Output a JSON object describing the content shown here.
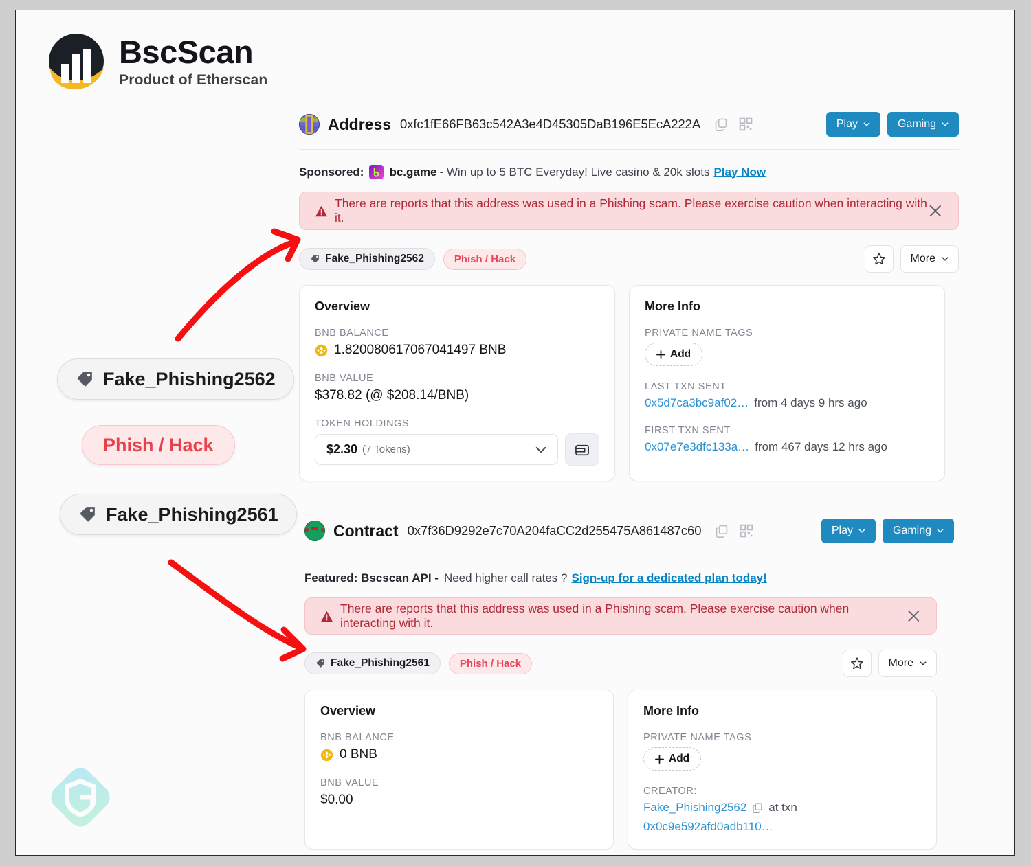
{
  "brand": {
    "name": "BscScan",
    "tagline": "Product of Etherscan",
    "logo_icon": "bscscan-logo-icon",
    "watermark_icon": "g-shield-watermark-icon"
  },
  "callouts": [
    {
      "id": "a",
      "label": "Fake_Phishing2562",
      "icon": "tag-icon",
      "style": "gray"
    },
    {
      "id": "b",
      "label": "Phish / Hack",
      "icon": "none",
      "style": "red"
    },
    {
      "id": "c",
      "label": "Fake_Phishing2561",
      "icon": "tag-icon",
      "style": "gray"
    }
  ],
  "annotations": {
    "arrow_color": "#f51111",
    "arrows": [
      {
        "name": "arrow-to-address-alert",
        "from": "callout-fake-phishing-2562",
        "to": "address-phishing-alert"
      },
      {
        "name": "arrow-to-contract-tag",
        "from": "callout-fake-phishing-2561",
        "to": "contract-name-tag"
      }
    ]
  },
  "sections": [
    {
      "kind_label": "Address",
      "hash": "0xfc1fE66FB63c542A3e4D45305DaB196E5EcA222A",
      "avatar_icon": "address-avatar-icon",
      "copy_icon": "copy-icon",
      "qr_icon": "qr-code-icon",
      "buttons": [
        {
          "label": "Play",
          "icon": "chevron-down-icon"
        },
        {
          "label": "Gaming",
          "icon": "chevron-down-icon"
        }
      ],
      "promo": {
        "type": "sponsored",
        "lead": "Sponsored:",
        "brand": "bc.game",
        "brand_icon": "bc-game-icon",
        "text": "- Win up to 5 BTC Everyday! Live casino & 20k slots",
        "cta": "Play Now"
      },
      "alert": {
        "icon": "warning-triangle-icon",
        "text": "There are reports that this address was used in a Phishing scam. Please exercise caution when interacting with it.",
        "close_icon": "close-icon",
        "bg": "#fadcdf",
        "fg": "#b02a37"
      },
      "name_tag": "Fake_Phishing2562",
      "name_tag_icon": "tag-icon",
      "label_badge": "Phish / Hack",
      "star_icon": "star-icon",
      "more_label": "More",
      "more_icon": "chevron-down-icon",
      "overview": {
        "title": "Overview",
        "balance_label": "BNB BALANCE",
        "balance_icon": "bnb-coin-icon",
        "balance_value": "1.820080617067041497 BNB",
        "value_label": "BNB VALUE",
        "value_value": "$378.82 (@ $208.14/BNB)",
        "holdings_label": "TOKEN HOLDINGS",
        "holdings_value": "$2.30",
        "holdings_sub": "(7 Tokens)",
        "holdings_chevron_icon": "chevron-down-icon",
        "wallet_icon": "wallet-icon"
      },
      "more_info": {
        "title": "More Info",
        "private_tags_label": "PRIVATE NAME TAGS",
        "add_label": "Add",
        "add_icon": "plus-icon",
        "rows": [
          {
            "label": "LAST TXN SENT",
            "link": "0x5d7ca3bc9af02…",
            "suffix": "from 4 days 9 hrs ago"
          },
          {
            "label": "FIRST TXN SENT",
            "link": "0x07e7e3dfc133a…",
            "suffix": "from 467 days 12 hrs ago"
          }
        ]
      }
    },
    {
      "kind_label": "Contract",
      "hash": "0x7f36D9292e7c70A204faCC2d255475A861487c60",
      "avatar_icon": "contract-avatar-icon",
      "copy_icon": "copy-icon",
      "qr_icon": "qr-code-icon",
      "buttons": [
        {
          "label": "Play",
          "icon": "chevron-down-icon"
        },
        {
          "label": "Gaming",
          "icon": "chevron-down-icon"
        }
      ],
      "promo": {
        "type": "featured",
        "lead": "Featured: Bscscan API -",
        "text": "Need higher call rates ?",
        "cta": "Sign-up for a dedicated plan today!"
      },
      "alert": {
        "icon": "warning-triangle-icon",
        "text": "There are reports that this address was used in a Phishing scam. Please exercise caution when interacting with it.",
        "close_icon": "close-icon",
        "bg": "#fadcdf",
        "fg": "#b02a37"
      },
      "name_tag": "Fake_Phishing2561",
      "name_tag_icon": "tag-icon",
      "label_badge": "Phish / Hack",
      "star_icon": "star-icon",
      "more_label": "More",
      "more_icon": "chevron-down-icon",
      "overview": {
        "title": "Overview",
        "balance_label": "BNB BALANCE",
        "balance_icon": "bnb-coin-icon",
        "balance_value": "0 BNB",
        "value_label": "BNB VALUE",
        "value_value": "$0.00"
      },
      "more_info": {
        "title": "More Info",
        "private_tags_label": "PRIVATE NAME TAGS",
        "add_label": "Add",
        "add_icon": "plus-icon",
        "creator_label": "CREATOR:",
        "creator_link": "Fake_Phishing2562",
        "creator_copy_icon": "copy-icon",
        "creator_mid": "at txn",
        "creator_txn": "0x0c9e592afd0adb110…"
      }
    }
  ],
  "colors": {
    "accent_blue": "#1f8ac0",
    "link_blue": "#2b92d4",
    "alert_bg": "#fadcdf",
    "alert_text": "#b02a37",
    "badge_red": "#e8485a",
    "arrow_red": "#f51111",
    "bnb_yellow": "#f0b90b"
  }
}
